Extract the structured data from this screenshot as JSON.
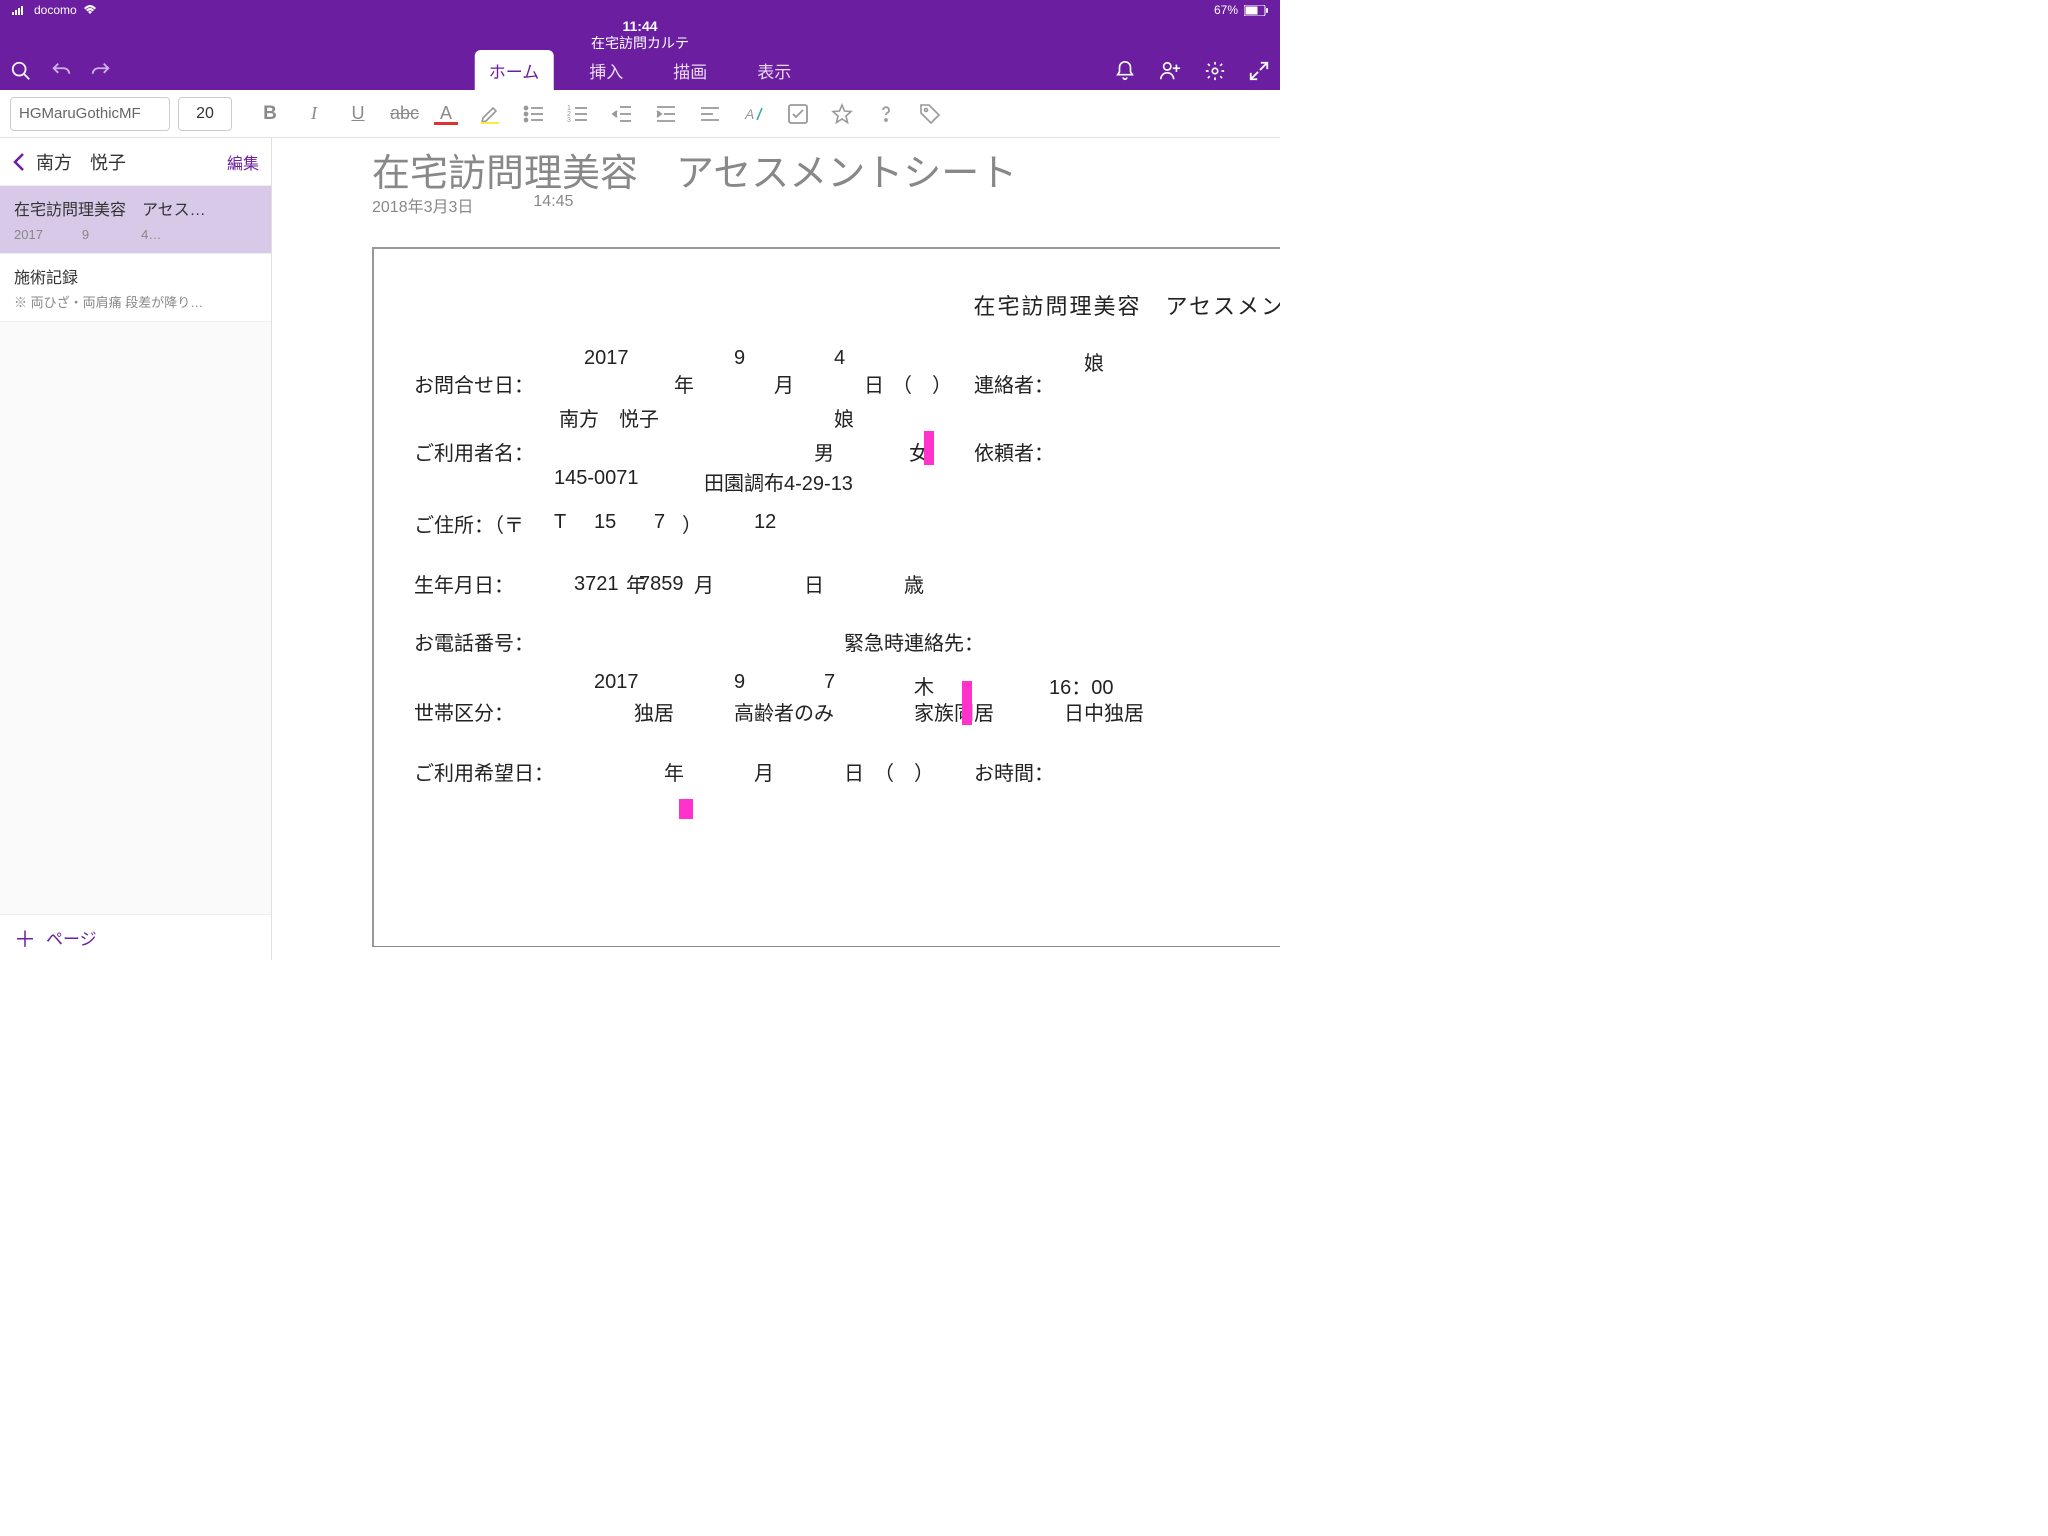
{
  "status": {
    "carrier": "docomo",
    "time": "11:44",
    "battery": "67%"
  },
  "header": {
    "title": "在宅訪問カルテ"
  },
  "tabs": [
    "ホーム",
    "挿入",
    "描画",
    "表示"
  ],
  "toolbar": {
    "font": "HGMaruGothicMF",
    "size": "20"
  },
  "sidebar": {
    "title": "南方　悦子",
    "edit": "編集",
    "items": [
      {
        "title": "在宅訪問理美容　アセス…",
        "sub": "2017　　　9　　　　4…"
      },
      {
        "title": "施術記録",
        "sub": "※ 両ひざ・両肩痛 段差が降り…"
      }
    ],
    "add": "ページ"
  },
  "page": {
    "titleCut": "在宅訪問理美容　アセスメントシート",
    "date": "2018年3月3日",
    "time": "14:45"
  },
  "form": {
    "heading": "在宅訪問理美容　アセスメントシート",
    "labels": {
      "contactDate": "お問合せ日：",
      "year": "年",
      "month": "月",
      "day": "日",
      "paren": "（　）",
      "contactBy": "連絡者：",
      "userName": "ご利用者名：",
      "male": "男",
      "female": "女",
      "requester": "依頼者：",
      "address": "ご住所：（〒",
      "addressEnd": "）",
      "dob": "生年月日：",
      "age": "歳",
      "phone": "お電話番号：",
      "emergency": "緊急時連絡先：",
      "household": "世帯区分：",
      "h1": "独居",
      "h2": "高齢者のみ",
      "h3": "家族同居",
      "h4": "日中独居",
      "wishDate": "ご利用希望日：",
      "wishTime": "お時間："
    },
    "values": {
      "y": "2017",
      "m": "9",
      "d": "4",
      "contactBy": "娘",
      "name": "南方　悦子",
      "requester": "娘",
      "zip": "145-0071",
      "addr": "田園調布4-29-13",
      "t1": "T",
      "t2": "15",
      "t3": "7",
      "t4": "12",
      "dob1": "3721",
      "dob2": "7859",
      "hy": "2017",
      "hm": "9",
      "hd": "7",
      "hw": "木",
      "ht": "16：00"
    }
  }
}
